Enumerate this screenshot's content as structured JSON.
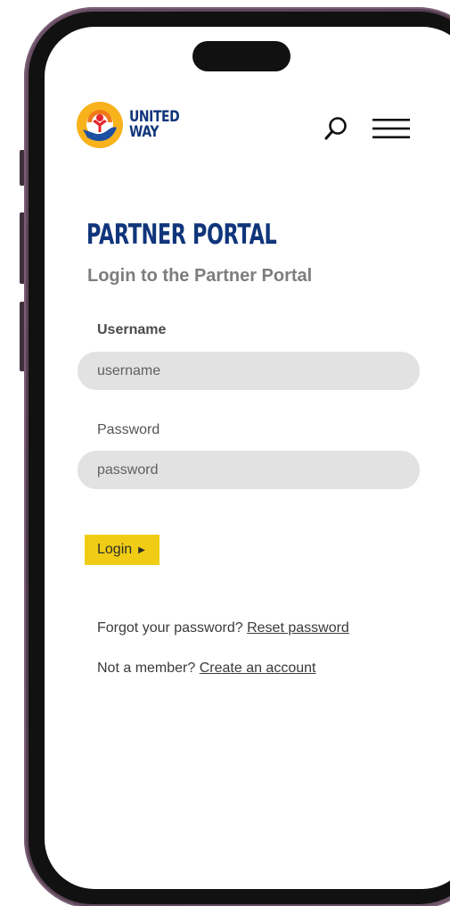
{
  "colors": {
    "brand_navy": "#10357a",
    "accent_yellow": "#f0cd14",
    "input_bg": "#e2e2e2",
    "subtitle_gray": "#7d7d7d",
    "phone_frame": "#5b4458"
  },
  "header": {
    "logo_line1": "UNITED",
    "logo_line2": "WAY",
    "search_icon": "search-icon",
    "menu_icon": "hamburger-menu-icon"
  },
  "main": {
    "title": "PARTNER PORTAL",
    "subtitle": "Login to the Partner Portal",
    "username": {
      "label": "Username",
      "value": "",
      "placeholder": "username"
    },
    "password": {
      "label": "Password",
      "value": "",
      "placeholder": "password"
    },
    "login_label": "Login",
    "login_arrow": "▶",
    "forgot_text": "Forgot your password?",
    "reset_link": "Reset password",
    "member_text": "Not a member?",
    "create_link": "Create an account"
  }
}
